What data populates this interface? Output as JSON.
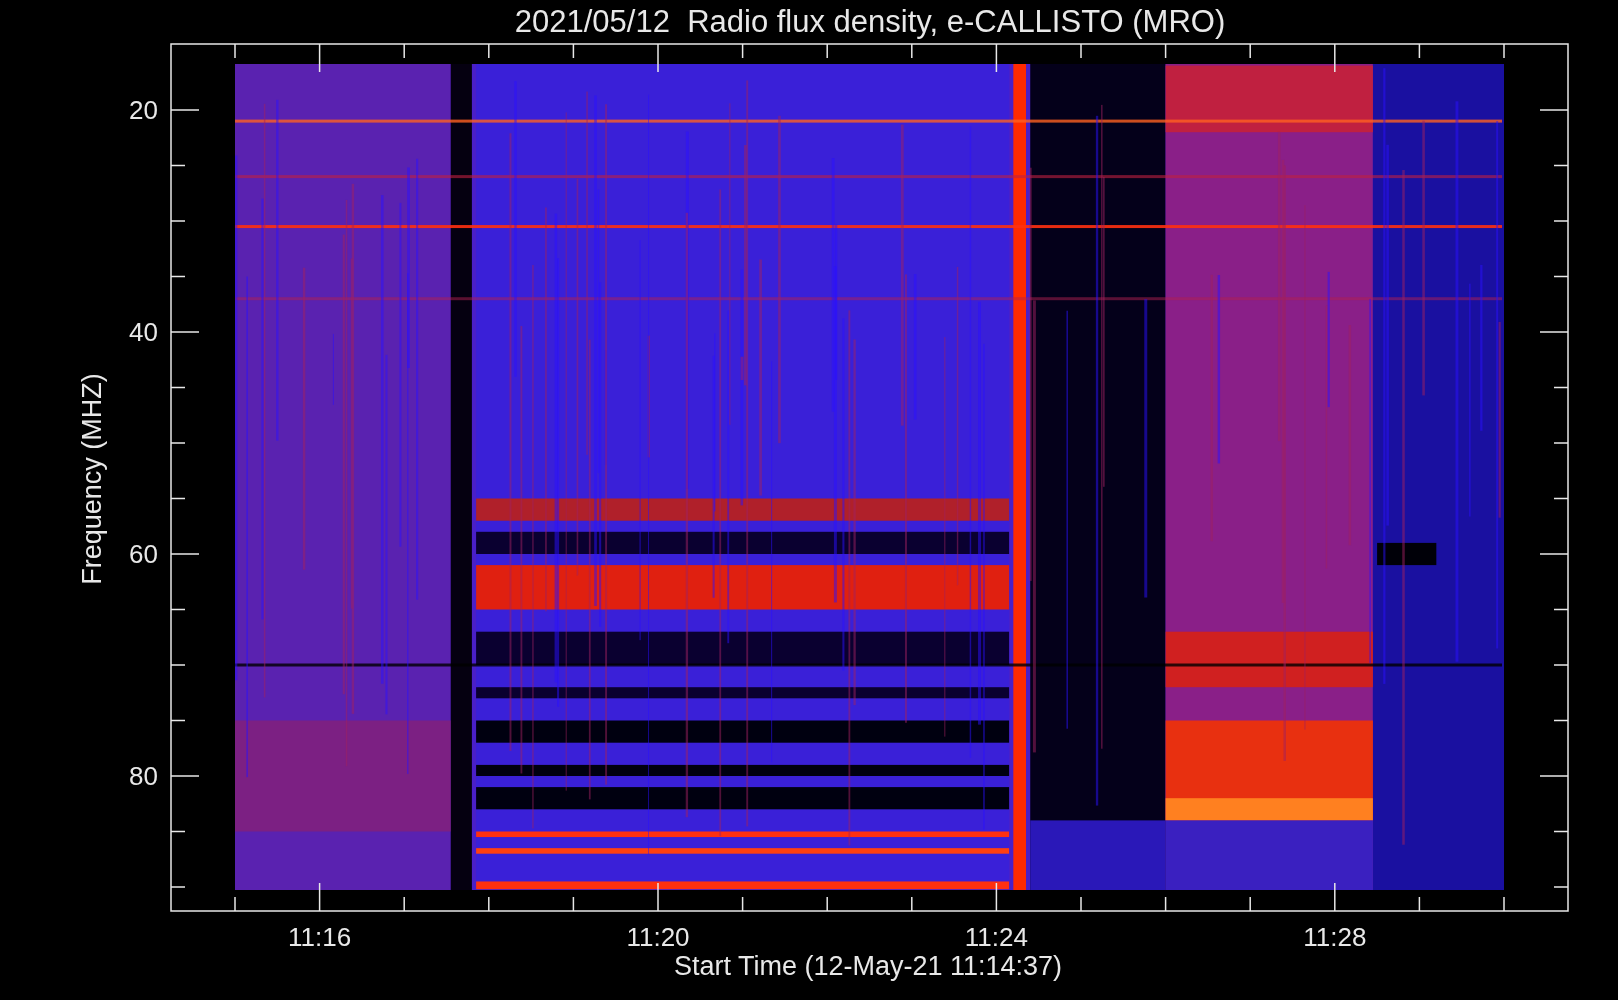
{
  "title": "2021/05/12  Radio flux density, e-CALLISTO (MRO)",
  "plot": {
    "ylabel": "Frequency (MHZ)",
    "xlabel": "Start Time (12-May-21 11:14:37)",
    "yticks": [
      "20",
      "40",
      "60",
      "80"
    ],
    "xticks": [
      "11:16",
      "11:20",
      "11:24",
      "11:28"
    ]
  }
}
